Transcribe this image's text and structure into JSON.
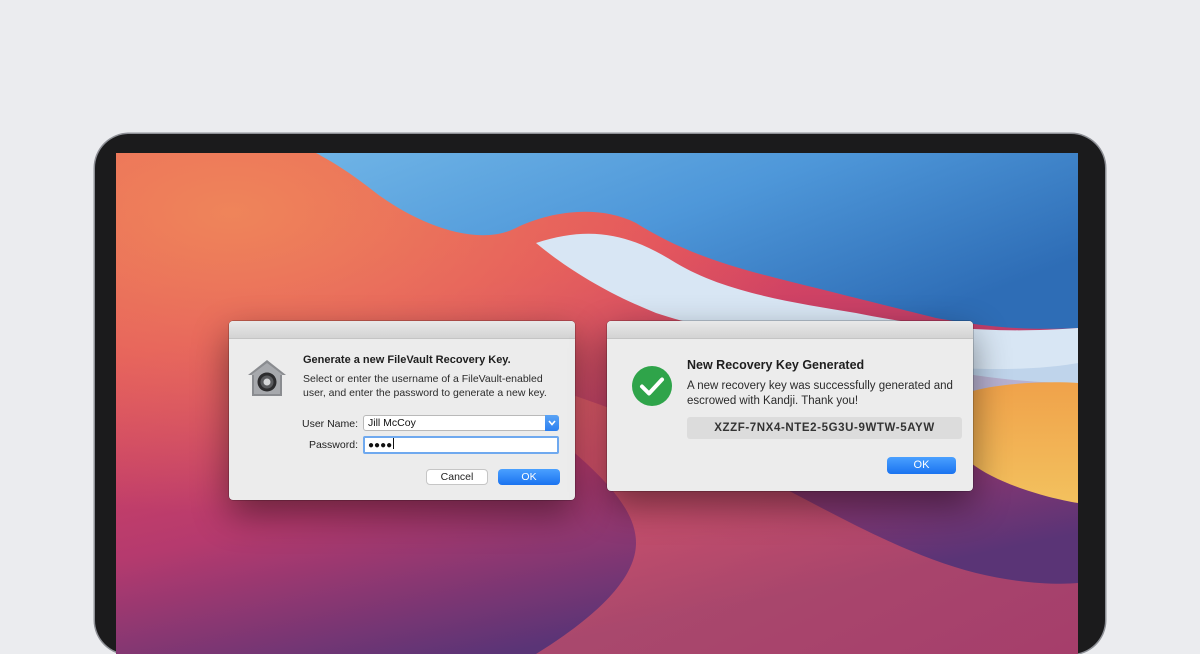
{
  "dialog_filevault": {
    "heading": "Generate a new FileVault Recovery Key.",
    "description": "Select or enter the username of a FileVault-enabled user, and enter the password to generate a new key.",
    "user_name_label": "User Name:",
    "user_name_value": "Jill McCoy",
    "password_label": "Password:",
    "password_value": "●●●●",
    "cancel_label": "Cancel",
    "ok_label": "OK",
    "icon": "lock-icon"
  },
  "dialog_success": {
    "heading": "New Recovery Key Generated",
    "description": "A new recovery key was successfully generated and escrowed with Kandji. Thank you!",
    "recovery_key": "XZZF-7NX4-NTE2-5G3U-9WTW-5AYW",
    "ok_label": "OK",
    "icon": "checkmark-icon"
  },
  "colors": {
    "accent_button": "#1a73f0",
    "success_green": "#2fa44a",
    "page_background": "#ebecef"
  }
}
